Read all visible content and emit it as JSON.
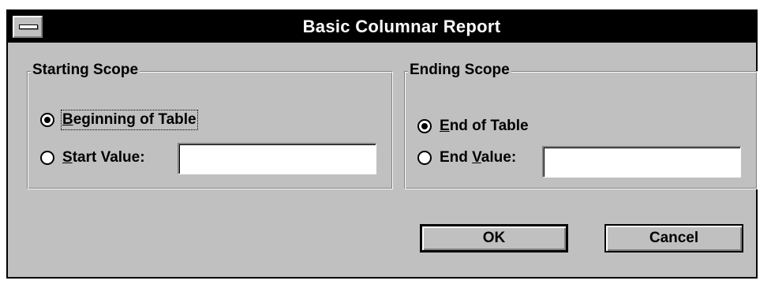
{
  "window": {
    "title": "Basic Columnar Report"
  },
  "starting_scope": {
    "legend": "Starting Scope",
    "options": [
      {
        "label": "Beginning of Table",
        "mnemonic": "B",
        "checked": true
      },
      {
        "label": "Start Value:",
        "mnemonic": "S",
        "checked": false
      }
    ],
    "start_value": ""
  },
  "ending_scope": {
    "legend": "Ending Scope",
    "options": [
      {
        "label": "End of Table",
        "mnemonic": "E",
        "checked": true
      },
      {
        "label": "End Value:",
        "mnemonic": "V",
        "checked": false
      }
    ],
    "end_value": ""
  },
  "buttons": {
    "ok": "OK",
    "cancel": "Cancel"
  },
  "colors": {
    "face": "#c0c0c0",
    "titlebar": "#000000",
    "title_text": "#ffffff"
  }
}
